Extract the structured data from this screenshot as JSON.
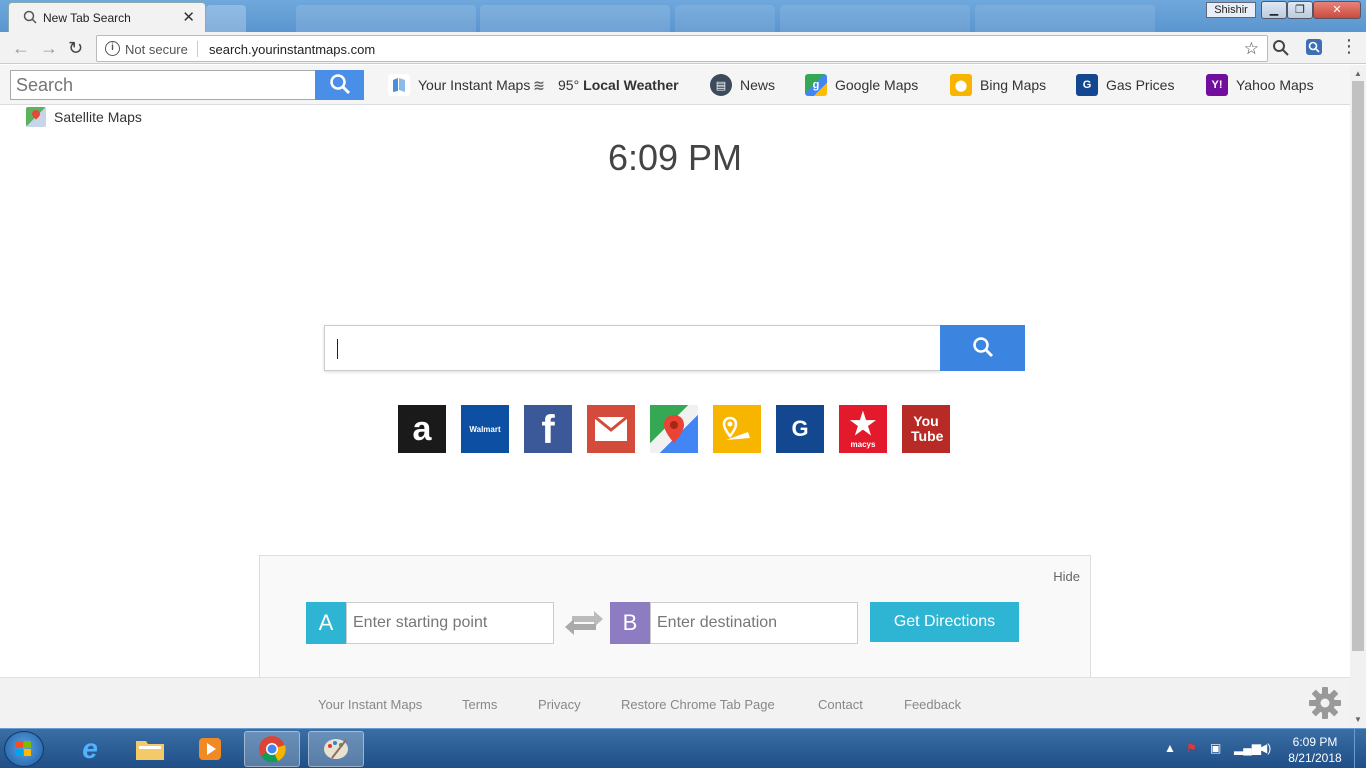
{
  "browser": {
    "tab_title": "New Tab Search",
    "user": "Shishir",
    "security_label": "Not secure",
    "url": "search.yourinstantmaps.com"
  },
  "extension_bar": {
    "search_placeholder": "Search",
    "links": [
      {
        "label": "Your Instant Maps",
        "icon": "maps-logo-icon"
      },
      {
        "label": "95°",
        "bold": "Local Weather",
        "icon": "weather-icon"
      },
      {
        "label": "News",
        "icon": "news-icon"
      },
      {
        "label": "Google Maps",
        "icon": "google-maps-icon"
      },
      {
        "label": "Bing Maps",
        "icon": "bing-maps-icon"
      },
      {
        "label": "Gas Prices",
        "icon": "gas-prices-icon"
      },
      {
        "label": "Yahoo Maps",
        "icon": "yahoo-maps-icon"
      }
    ],
    "satellite_label": "Satellite Maps"
  },
  "clock": "6:09 PM",
  "tiles": [
    {
      "name": "amazon",
      "label": "a",
      "color": "#1a1a1a"
    },
    {
      "name": "walmart",
      "label": "Walmart",
      "color": "#0d4fa3"
    },
    {
      "name": "facebook",
      "label": "f",
      "color": "#3b5998"
    },
    {
      "name": "gmail",
      "label": "",
      "color": "#d44a3b"
    },
    {
      "name": "google-maps",
      "label": "",
      "color": "#34a853"
    },
    {
      "name": "bing-maps",
      "label": "",
      "color": "#f7b500"
    },
    {
      "name": "gas-prices",
      "label": "G",
      "color": "#13478f"
    },
    {
      "name": "macys",
      "label": "macys",
      "color": "#e21a2c"
    },
    {
      "name": "youtube",
      "label": "You Tube",
      "color": "#b72a25"
    }
  ],
  "directions": {
    "hide_label": "Hide",
    "a_label": "A",
    "b_label": "B",
    "start_placeholder": "Enter starting point",
    "dest_placeholder": "Enter destination",
    "button_label": "Get Directions",
    "a_color": "#2fb5d4",
    "b_color": "#8e7cc3"
  },
  "footer": {
    "links": [
      "Your Instant Maps",
      "Terms",
      "Privacy",
      "Restore Chrome Tab Page",
      "Contact",
      "Feedback"
    ]
  },
  "taskbar": {
    "time": "6:09 PM",
    "date": "8/21/2018"
  }
}
